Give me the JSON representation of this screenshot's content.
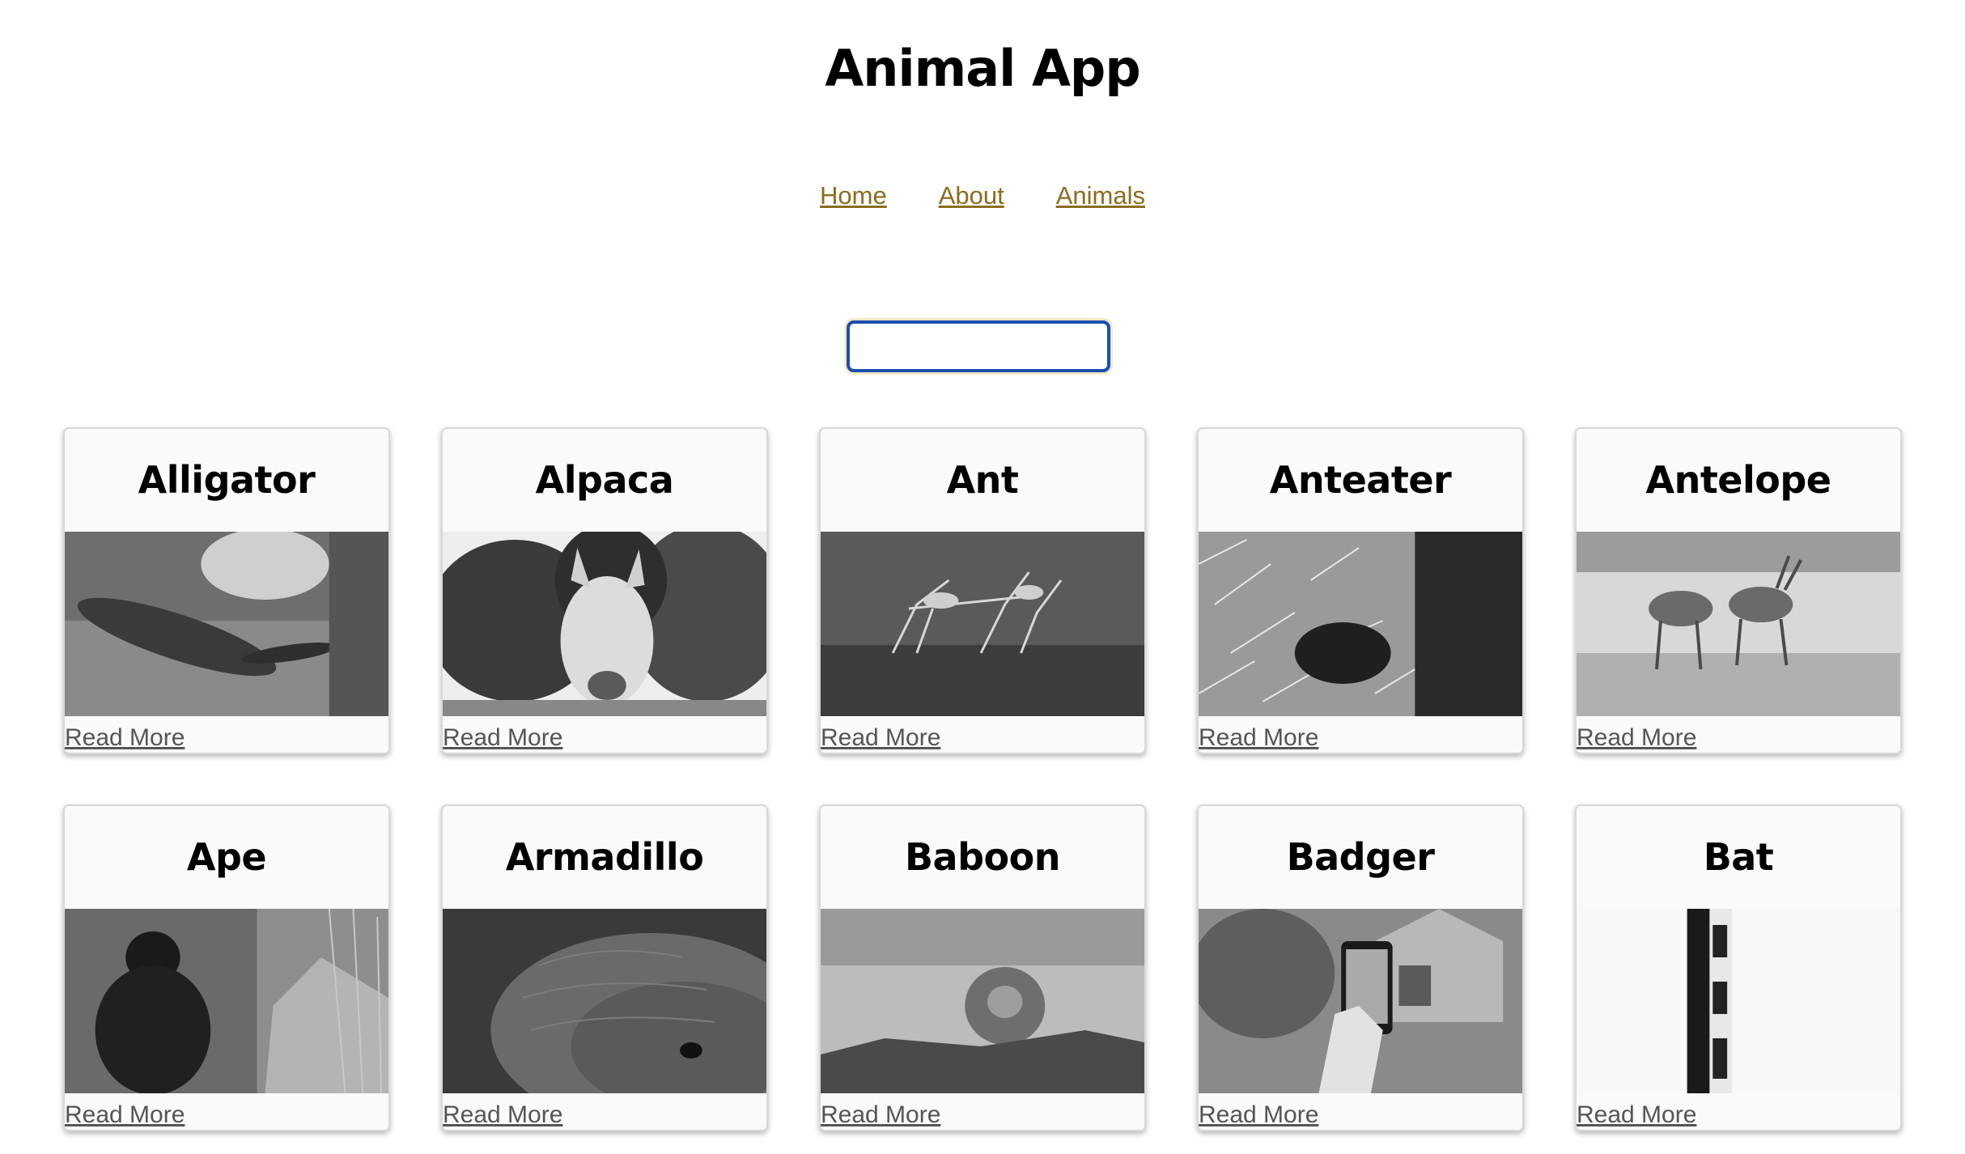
{
  "header": {
    "title": "Animal App"
  },
  "nav": [
    {
      "label": "Home"
    },
    {
      "label": "About"
    },
    {
      "label": "Animals"
    }
  ],
  "search": {
    "value": "",
    "placeholder": ""
  },
  "cards": [
    {
      "name": "Alligator",
      "image": "alligator-photo",
      "link": "Read More"
    },
    {
      "name": "Alpaca",
      "image": "alpaca-photo",
      "link": "Read More"
    },
    {
      "name": "Ant",
      "image": "ant-photo",
      "link": "Read More"
    },
    {
      "name": "Anteater",
      "image": "anteater-photo",
      "link": "Read More"
    },
    {
      "name": "Antelope",
      "image": "antelope-photo",
      "link": "Read More"
    },
    {
      "name": "Ape",
      "image": "ape-photo",
      "link": "Read More"
    },
    {
      "name": "Armadillo",
      "image": "armadillo-photo",
      "link": "Read More"
    },
    {
      "name": "Baboon",
      "image": "baboon-photo",
      "link": "Read More"
    },
    {
      "name": "Badger",
      "image": "badger-photo",
      "link": "Read More"
    },
    {
      "name": "Bat",
      "image": "bat-photo",
      "link": "Read More"
    }
  ],
  "colors": {
    "nav_link": "#8a6d1f",
    "search_border": "#1b4fb0",
    "read_more": "#555555"
  }
}
